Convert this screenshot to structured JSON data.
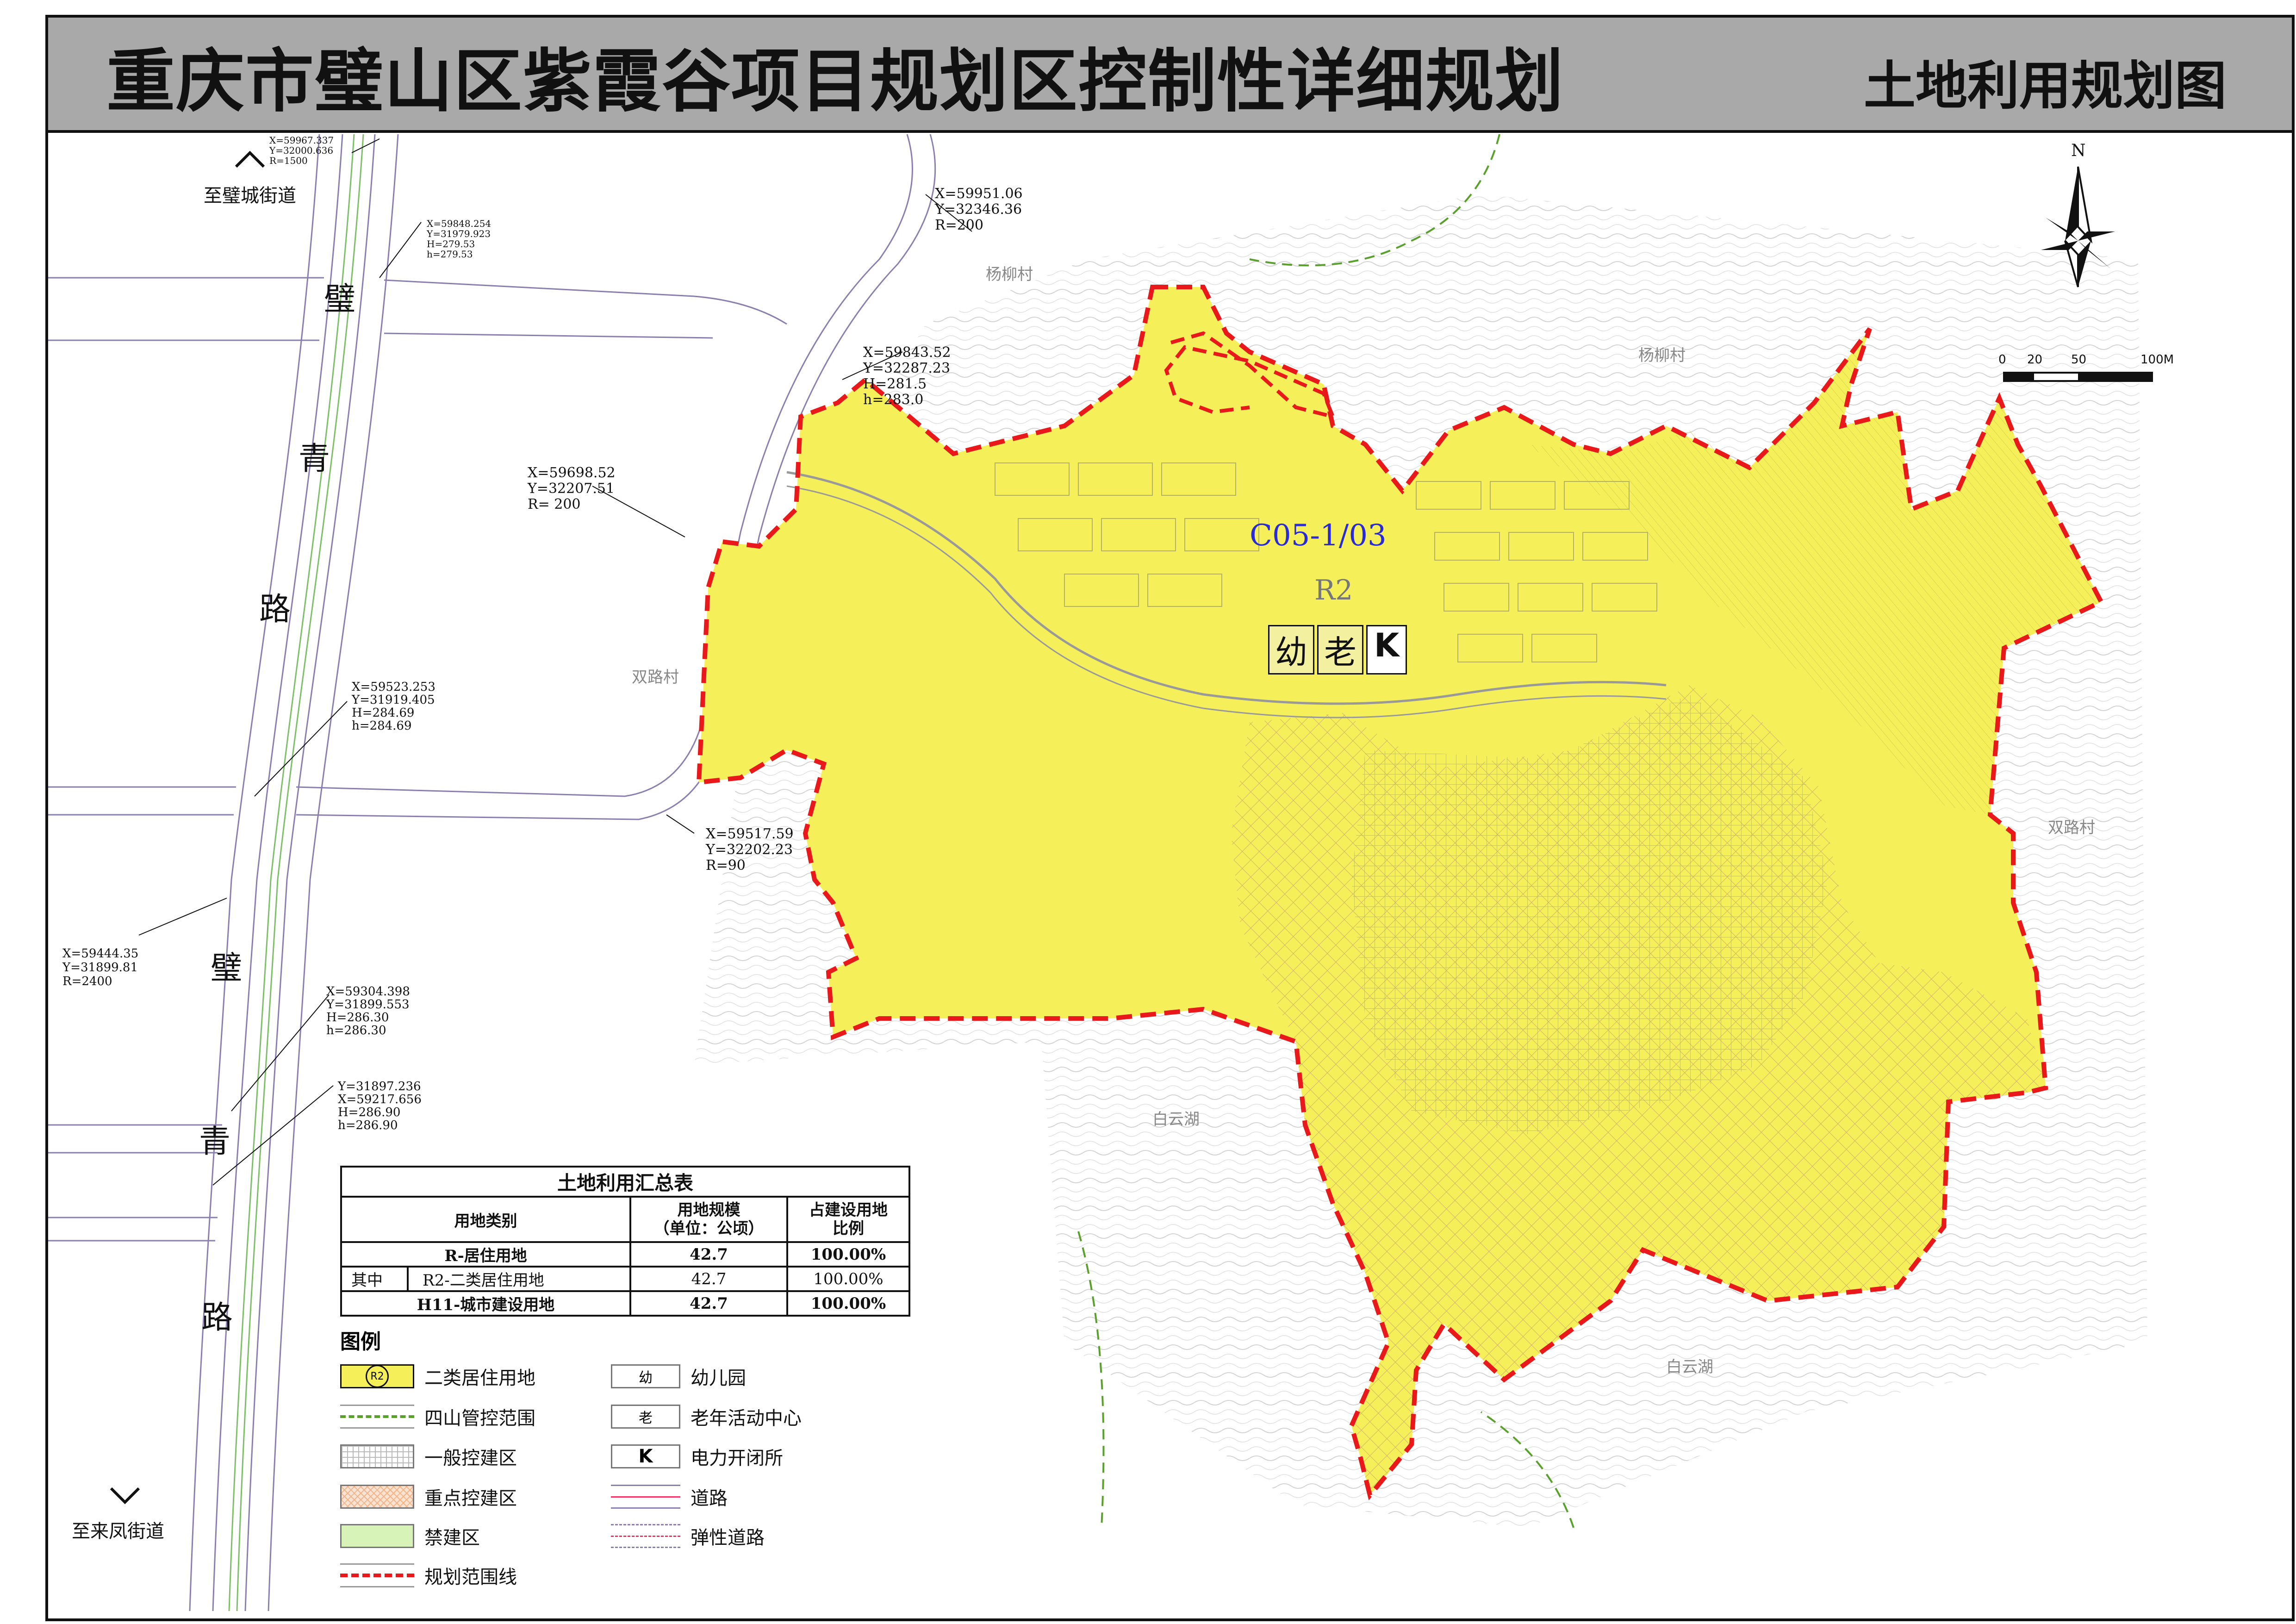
{
  "title": "重庆市璧山区紫霞谷项目规划区控制性详细规划",
  "subtitle": "土地利用规划图",
  "north": {
    "label": "N"
  },
  "scale_bar": {
    "labels": [
      "0",
      "20",
      "50",
      "100M"
    ]
  },
  "directions": {
    "top": "至璧城街道",
    "bottom": "至来凤街道"
  },
  "road_name_chars": [
    "璧",
    "青",
    "路",
    "璧",
    "青",
    "路"
  ],
  "villages": [
    "杨柳村",
    "杨柳村",
    "双路村",
    "双路村",
    "白云湖",
    "白云湖"
  ],
  "parcel": {
    "code": "C05-1/03",
    "landuse": "R2",
    "facilities": [
      "幼",
      "老",
      "K"
    ]
  },
  "coords": [
    "X=59967.337\nY=32000.636\nR=1500",
    "X=59848.254\nY=31979.923\nH=279.53\nh=279.53",
    "X=59951.06\nY=32346.36\nR=200",
    "X=59843.52\nY=32287.23\nH=281.5\nh=283.0",
    "X=59698.52\nY=32207.51\nR= 200",
    "X=59523.253\nY=31919.405\nH=284.69\nh=284.69",
    "X=59517.59\nY=32202.23\nR=90",
    "X=59444.35\nY=31899.81\nR=2400",
    "X=59304.398\nY=31899.553\nH=286.30\nh=286.30",
    "Y=31897.236\nX=59217.656\nH=286.90\nh=286.90"
  ],
  "summary_table": {
    "title": "土地利用汇总表",
    "headers": [
      "用地类别",
      "用地规模\n（单位：公顷）",
      "占建设用地\n比例"
    ],
    "rows": [
      {
        "group": "",
        "category": "R-居住用地",
        "area": "42.7",
        "ratio": "100.00%"
      },
      {
        "group": "其中",
        "category": "R2-二类居住用地",
        "area": "42.7",
        "ratio": "100.00%"
      },
      {
        "group": "",
        "category": "H11-城市建设用地",
        "area": "42.7",
        "ratio": "100.00%"
      }
    ]
  },
  "legend": {
    "title": "图例",
    "items_left": [
      {
        "symbol": "R2",
        "label": "二类居住用地",
        "color": "#f5f05a"
      },
      {
        "symbol": "",
        "label": "四山管控范围",
        "color": "#5aa02c"
      },
      {
        "symbol": "",
        "label": "一般控建区",
        "color": "#bbbbbb"
      },
      {
        "symbol": "",
        "label": "重点控建区",
        "color": "#f3b48a"
      },
      {
        "symbol": "",
        "label": "禁建区",
        "color": "#d8f3b8"
      },
      {
        "symbol": "",
        "label": "规划范围线",
        "color": "#e8181b"
      }
    ],
    "items_right": [
      {
        "symbol": "幼",
        "label": "幼儿园"
      },
      {
        "symbol": "老",
        "label": "老年活动中心"
      },
      {
        "symbol": "K",
        "label": "电力开闭所"
      },
      {
        "symbol": "",
        "label": "道路"
      },
      {
        "symbol": "",
        "label": "弹性道路"
      }
    ]
  },
  "colors": {
    "residential": "#f5f05a",
    "boundary": "#e8181b",
    "title_bar": "#a9a9a9",
    "ecology_line": "#5aa02c"
  }
}
